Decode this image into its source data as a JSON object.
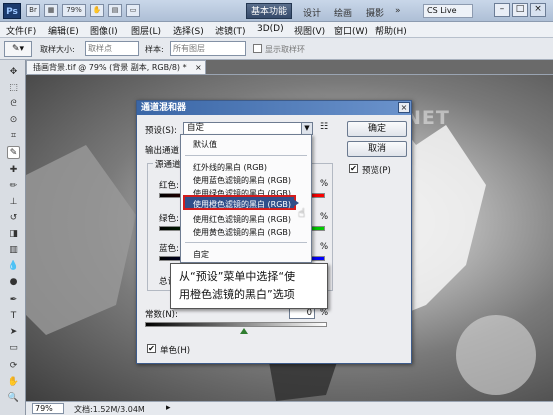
{
  "app": {
    "logo": "Ps",
    "workspace_active": "基本功能",
    "workspace_items": [
      "设计",
      "绘画",
      "摄影"
    ],
    "cs_live": "CS Live"
  },
  "titlebar": {
    "icons": [
      "br-icon",
      "mini-bridge-icon",
      "zoom-level-icon",
      "arrange-icon",
      "screen-mode-icon"
    ],
    "zoom": "79%"
  },
  "menu": [
    "文件(F)",
    "编辑(E)",
    "图像(I)",
    "图层(L)",
    "选择(S)",
    "滤镜(T)",
    "3D(D)",
    "视图(V)",
    "窗口(W)",
    "帮助(H)"
  ],
  "options": {
    "sample_size_label": "取样大小:",
    "sample_size_value": "取样点",
    "sample_label": "样本:",
    "sample_value": "所有图层",
    "ring_label": "显示取样环"
  },
  "document": {
    "tab": "插画背景.tif @ 79% (背景 副本, RGB/8) *",
    "close": "×"
  },
  "watermark": "WWW.TLVI.NET",
  "status": {
    "zoom": "79%",
    "doc": "文档:1.52M/3.04M"
  },
  "dialog": {
    "title": "通道混和器",
    "preset_label": "预设(S):",
    "preset_value": "自定",
    "output_label": "输出通道:",
    "source_label": "源通道",
    "red_label": "红色:",
    "green_label": "绿色:",
    "blue_label": "蓝色:",
    "total_label": "总计:",
    "const_label": "常数(N):",
    "mono_label": "单色(H)",
    "preview_label": "预览(P)",
    "ok": "确定",
    "cancel": "取消",
    "pct": "%",
    "const_value": "0",
    "mono_checked": "✔",
    "preview_checked": "✔"
  },
  "dropdown": {
    "items": [
      "默认值",
      "红外线的黑白 (RGB)",
      "使用蓝色滤镜的黑白 (RGB)",
      "使用绿色滤镜的黑白 (RGB)",
      "使用橙色滤镜的黑白 (RGB)",
      "使用红色滤镜的黑白 (RGB)",
      "使用黄色滤镜的黑白 (RGB)",
      "自定"
    ],
    "highlighted_index": 4
  },
  "callout": {
    "line1": "从“预设”菜单中选择“使",
    "line2": "用橙色滤镜的黑白”选项"
  },
  "colors": {
    "highlight": "#304f8a",
    "callout_border": "#d21d1d",
    "titlebar": "#3a66a6"
  }
}
